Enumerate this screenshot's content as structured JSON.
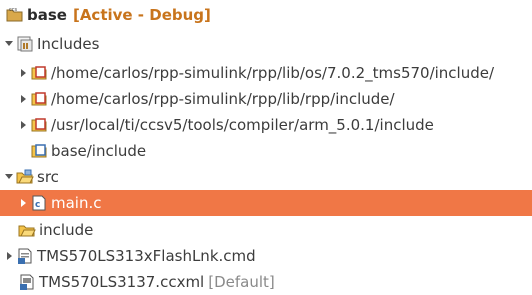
{
  "project": {
    "name": "base",
    "config": "[Active - Debug]",
    "icon": "ccs-project-icon"
  },
  "includes": {
    "label": "Includes",
    "icon": "includes-icon",
    "items": [
      "/home/carlos/rpp-simulink/rpp/lib/os/7.0.2_tms570/include/",
      "/home/carlos/rpp-simulink/rpp/lib/rpp/include/",
      "/usr/local/ti/ccsv5/tools/compiler/arm_5.0.1/include",
      "base/include"
    ]
  },
  "src": {
    "label": "src",
    "icon": "source-folder-icon",
    "file": "main.c"
  },
  "include_folder": {
    "label": "include",
    "icon": "folder-icon"
  },
  "files": [
    {
      "label": "TMS570LS313xFlashLnk.cmd",
      "icon": "cmd-file-icon"
    },
    {
      "label": "TMS570LS3137.ccxml",
      "decoration": "[Default]",
      "icon": "ccxml-file-icon"
    }
  ],
  "colors": {
    "selection": "#f07746",
    "config_label": "#c8741c"
  }
}
